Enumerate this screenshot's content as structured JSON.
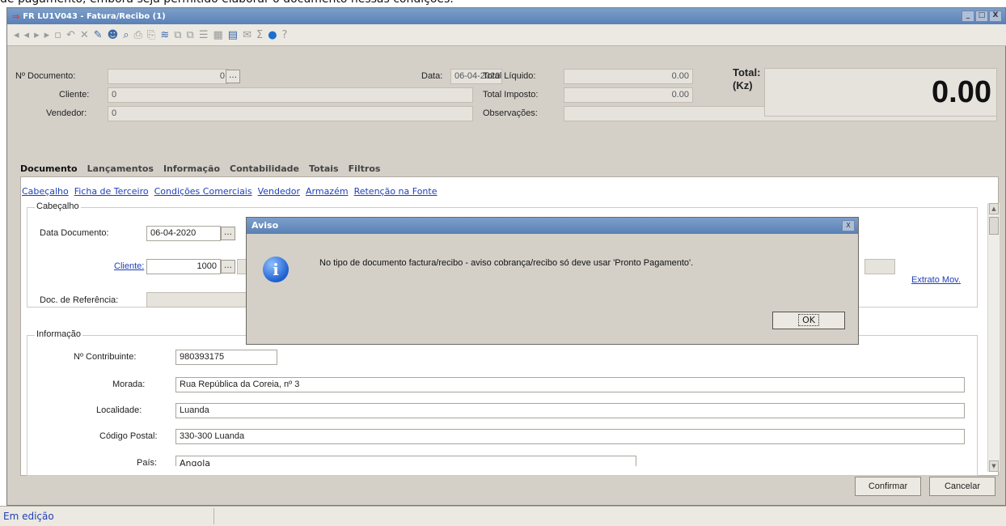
{
  "top_caption": "de pagamento, embora seja permitido elaborar o documento nessas condições.",
  "window": {
    "title": "FR LU1V043 - Fatura/Recibo (1)",
    "controls": [
      "_",
      "□",
      "X"
    ]
  },
  "header": {
    "doc_label": "Nº Documento:",
    "doc_value": "0",
    "date_label": "Data:",
    "date_value": "06-04-2020",
    "client_label": "Cliente:",
    "client_value": "0",
    "seller_label": "Vendedor:",
    "seller_value": "0",
    "net_label": "Total Líquido:",
    "net_value": "0.00",
    "tax_label": "Total Imposto:",
    "tax_value": "0.00",
    "notes_label": "Observações:",
    "total_label": "Total:",
    "total_unit": "(Kz)",
    "total_value": "0.00"
  },
  "tabs": [
    "Documento",
    "Lançamentos",
    "Informação",
    "Contabilidade",
    "Totais",
    "Filtros"
  ],
  "links": [
    "Cabeçalho",
    "Ficha de Terceiro",
    "Condições Comerciais",
    "Vendedor",
    "Armazém",
    "Retenção na Fonte"
  ],
  "cabecalho": {
    "title": "Cabeçalho",
    "doc_date_label": "Data Documento:",
    "doc_date_value": "06-04-2020",
    "client_label": "Cliente:",
    "client_value": "1000",
    "ref_label": "Doc. de Referência:",
    "extrato_label": "Extrato Mov."
  },
  "informacao": {
    "title": "Informação",
    "nif_label": "Nº Contribuinte:",
    "nif_value": "980393175",
    "morada_label": "Morada:",
    "morada_value": "Rua República da Coreia, nº 3",
    "localidade_label": "Localidade:",
    "localidade_value": "Luanda",
    "cp_label": "Código Postal:",
    "cp_value": "330-300 Luanda",
    "pais_label": "País:",
    "pais_value": "Angola"
  },
  "buttons": {
    "confirm": "Confirmar",
    "cancel": "Cancelar"
  },
  "status": {
    "text": "Em edição"
  },
  "dialog": {
    "title": "Aviso",
    "message": "No tipo de documento factura/recibo  - aviso cobrança/recibo só deve usar 'Pronto Pagamento'.",
    "ok": "OK",
    "close": "X"
  }
}
